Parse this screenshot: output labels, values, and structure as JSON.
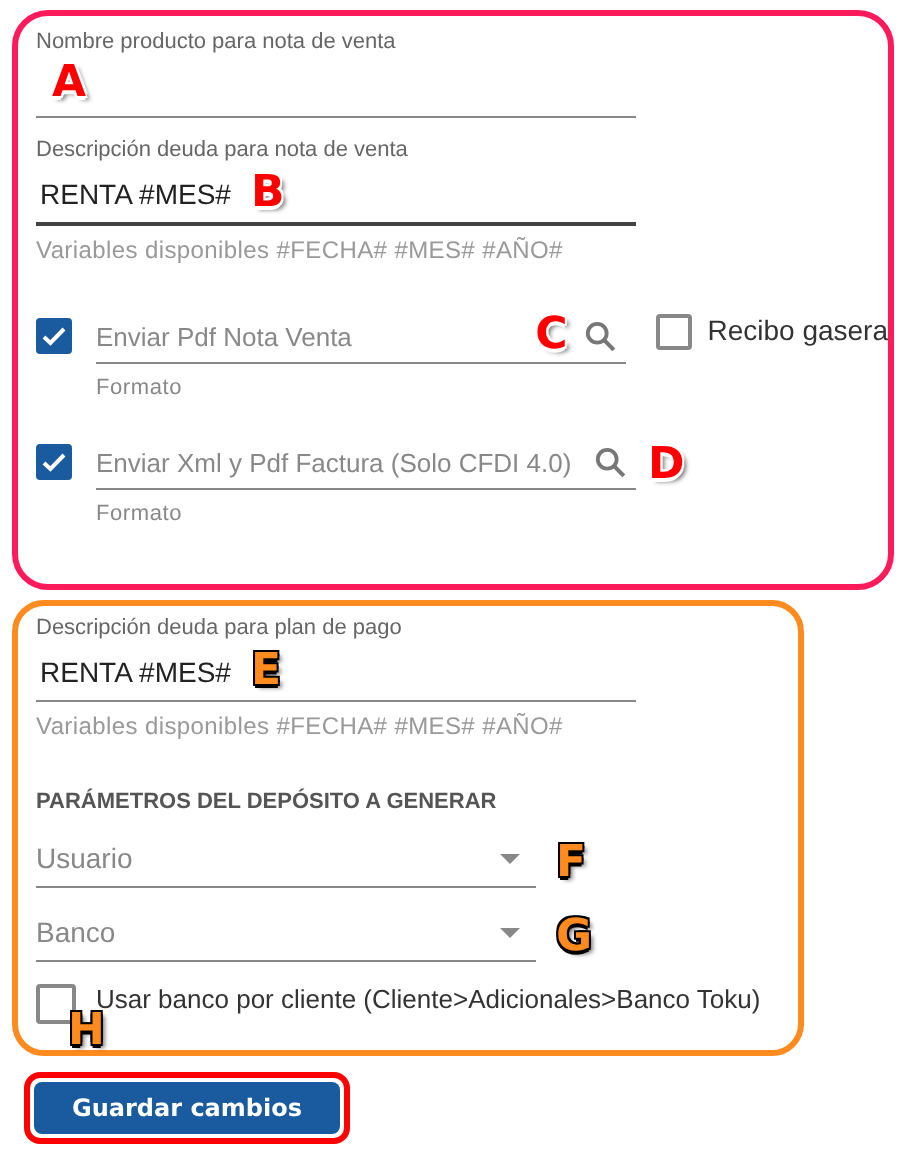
{
  "sale_note": {
    "product_name": {
      "label": "Nombre producto para nota de venta",
      "marker": {
        "letter": "A",
        "color": "#ff0000"
      }
    },
    "debt_description": {
      "label": "Descripción deuda para nota de venta",
      "value": "RENTA #MES#",
      "hint": "Variables disponibles #FECHA# #MES# #AÑO#",
      "marker": {
        "letter": "B",
        "color": "#ff0000"
      }
    },
    "formats": [
      {
        "checked": true,
        "placeholder": "Enviar Pdf Nota Venta",
        "caption": "Formato",
        "marker": {
          "letter": "C",
          "color": "#ff0000"
        }
      },
      {
        "checked": true,
        "placeholder": "Enviar Xml y Pdf Factura (Solo CFDI 4.0)",
        "caption": "Formato",
        "marker": {
          "letter": "D",
          "color": "#ff0000"
        }
      }
    ],
    "gas_receipt": {
      "label": "Recibo gasera",
      "checked": false
    }
  },
  "payment_plan": {
    "debt_description": {
      "label": "Descripción deuda para plan de pago",
      "value": "RENTA #MES#",
      "hint": "Variables disponibles #FECHA# #MES# #AÑO#",
      "marker": {
        "letter": "E",
        "color": "#ff8a1e"
      }
    },
    "section_title": "PARÁMETROS DEL DEPÓSITO A GENERAR",
    "selects": [
      {
        "placeholder": "Usuario",
        "marker": {
          "letter": "F",
          "color": "#ff8a1e"
        }
      },
      {
        "placeholder": "Banco",
        "marker": {
          "letter": "G",
          "color": "#ff8a1e"
        }
      }
    ],
    "bank_per_client": {
      "label": "Usar banco por cliente (Cliente>Adicionales>Banco Toku)",
      "checked": false,
      "marker": {
        "letter": "H",
        "color": "#ff8a1e"
      }
    }
  },
  "save_button": {
    "label": "Guardar cambios"
  }
}
